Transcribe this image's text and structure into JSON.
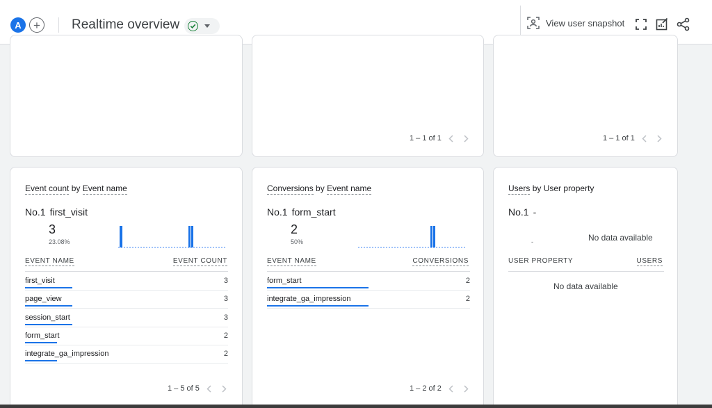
{
  "header": {
    "avatar_letter": "A",
    "page_title": "Realtime overview",
    "snapshot_label": "View user snapshot"
  },
  "top_cards": [
    {
      "pager": "1 – 1 of 1"
    },
    {
      "pager": "1 – 1 of 1"
    }
  ],
  "event_card": {
    "title_metric": "Event count",
    "title_by": "by",
    "title_dim": "Event name",
    "rank": "No.1",
    "top_item": "first_visit",
    "value": "3",
    "percent": "23.08%",
    "col_left": "EVENT NAME",
    "col_right": "EVENT COUNT",
    "rows": [
      {
        "name": "first_visit",
        "value": "3",
        "share": 1.0
      },
      {
        "name": "page_view",
        "value": "3",
        "share": 1.0
      },
      {
        "name": "session_start",
        "value": "3",
        "share": 1.0
      },
      {
        "name": "form_start",
        "value": "2",
        "share": 0.67
      },
      {
        "name": "integrate_ga_impression",
        "value": "2",
        "share": 0.67
      }
    ],
    "pager": "1 – 5 of 5"
  },
  "conversion_card": {
    "title_metric": "Conversions",
    "title_by": "by",
    "title_dim": "Event name",
    "rank": "No.1",
    "top_item": "form_start",
    "value": "2",
    "percent": "50%",
    "col_left": "EVENT NAME",
    "col_right": "CONVERSIONS",
    "rows": [
      {
        "name": "form_start",
        "value": "2",
        "share": 1.0
      },
      {
        "name": "integrate_ga_impression",
        "value": "2",
        "share": 1.0
      }
    ],
    "pager": "1 – 2 of 2"
  },
  "users_card": {
    "title_metric": "Users",
    "title_by": "by",
    "title_dim": "User property",
    "rank": "No.1",
    "top_item": "-",
    "no_data_top": "No data available",
    "small_dash": "-",
    "col_left": "USER PROPERTY",
    "col_right": "USERS",
    "no_data_table": "No data available"
  },
  "colors": {
    "accent": "#1a73e8",
    "status_ok": "#188038"
  },
  "icons": [
    "plus-icon",
    "check-icon",
    "chevron-down-icon",
    "user-snapshot-icon",
    "fullscreen-icon",
    "customize-report-icon",
    "share-icon",
    "chevron-left-icon",
    "chevron-right-icon"
  ]
}
